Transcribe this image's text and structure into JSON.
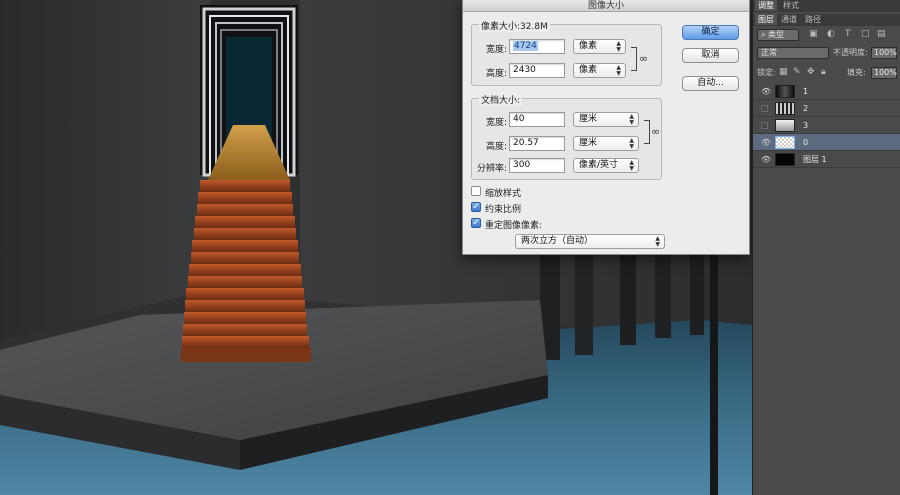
{
  "dialog": {
    "title": "图像大小",
    "pixel_group_title": "像素大小:32.8M",
    "pixel_width_label": "宽度:",
    "pixel_width_value": "4724",
    "pixel_width_unit": "像素",
    "pixel_height_label": "高度:",
    "pixel_height_value": "2430",
    "pixel_height_unit": "像素",
    "doc_group_title": "文档大小:",
    "doc_width_label": "宽度:",
    "doc_width_value": "40",
    "doc_width_unit": "厘米",
    "doc_height_label": "高度:",
    "doc_height_value": "20.57",
    "doc_height_unit": "厘米",
    "resolution_label": "分辨率:",
    "resolution_value": "300",
    "resolution_unit": "像素/英寸",
    "scale_styles_label": "缩放样式",
    "scale_styles_checked": false,
    "constrain_label": "约束比例",
    "constrain_checked": true,
    "resample_label": "重定图像像素:",
    "resample_checked": true,
    "resample_method": "两次立方（自动）",
    "ok_label": "确定",
    "cancel_label": "取消",
    "auto_label": "自动..."
  },
  "panel": {
    "top_tabs": [
      "调整",
      "样式"
    ],
    "layer_tabs": [
      "图层",
      "通道",
      "路径"
    ],
    "filter_kind": "类型",
    "blend_mode": "正常",
    "opacity_label": "不透明度:",
    "opacity_value": "100%",
    "lock_label": "锁定:",
    "fill_label": "填充:",
    "fill_value": "100%",
    "layers": [
      {
        "name": "1",
        "visible": true,
        "selected": false
      },
      {
        "name": "2",
        "visible": false,
        "selected": false
      },
      {
        "name": "3",
        "visible": false,
        "selected": false
      },
      {
        "name": "0",
        "visible": true,
        "selected": true
      },
      {
        "name": "图层 1",
        "visible": true,
        "selected": false
      }
    ]
  },
  "colors": {
    "accent": "#5d9be6",
    "panel_bg": "#4a4a4a",
    "selected_layer": "#5d6a80"
  }
}
